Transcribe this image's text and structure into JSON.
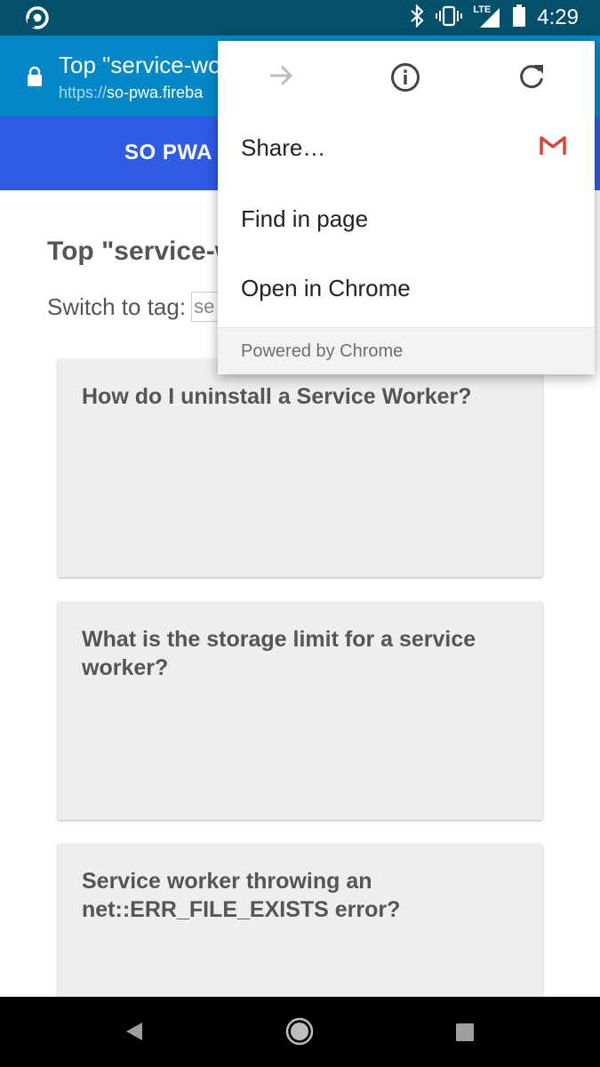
{
  "status_bar": {
    "time": "4:29",
    "network_label": "LTE",
    "icons": [
      "app-notification-icon",
      "bluetooth-icon",
      "vibrate-icon",
      "signal-icon",
      "battery-icon"
    ]
  },
  "custom_tab": {
    "title": "Top \"service-wo",
    "url_scheme": "https://",
    "url_host": "so-pwa.fireba",
    "icons": [
      "lock-icon"
    ]
  },
  "app": {
    "title": "SO PWA"
  },
  "page": {
    "heading": "Top \"service-w",
    "tag_label": "Switch to tag:",
    "tag_input_value": "se"
  },
  "cards": [
    {
      "title": "How do I uninstall a Service Worker?"
    },
    {
      "title": "What is the storage limit for a service worker?"
    },
    {
      "title": "Service worker throwing an net::ERR_FILE_EXISTS error?"
    }
  ],
  "menu": {
    "icon_row": [
      "forward-icon",
      "info-icon",
      "refresh-icon"
    ],
    "items": [
      {
        "label": "Share…",
        "icon": "gmail-icon"
      },
      {
        "label": "Find in page"
      },
      {
        "label": "Open in Chrome"
      }
    ],
    "footer": "Powered by Chrome"
  },
  "nav_bar": {
    "icons": [
      "back-icon",
      "home-icon",
      "recents-icon"
    ]
  },
  "colors": {
    "status_bar": "#03506b",
    "toolbar": "#0288c7",
    "app_header": "#2f5be6",
    "card": "#eeeeee"
  }
}
